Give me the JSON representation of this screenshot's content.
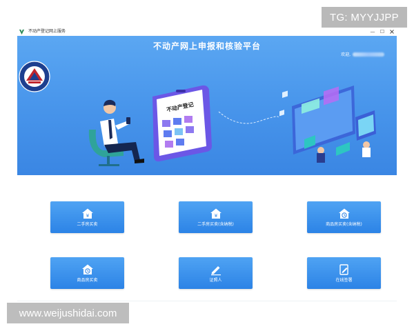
{
  "overlay": {
    "tg_text": "TG: MYYJJPP"
  },
  "window": {
    "title": "不动产登记网上服务",
    "minimize_glyph": "—",
    "maximize_glyph": "☐"
  },
  "banner": {
    "title": "不动产网上申报和核验平台",
    "welcome_label": "欢迎,",
    "tablet_label": "不动产登记"
  },
  "tiles": [
    {
      "label": "二手房买卖",
      "icon": "house-yen-icon"
    },
    {
      "label": "二手房买卖(含纳税)",
      "icon": "house-yen-icon"
    },
    {
      "label": "商品房买卖(含纳税)",
      "icon": "house-clock-icon"
    },
    {
      "label": "商品房买卖",
      "icon": "house-clock-icon"
    },
    {
      "label": "证照人",
      "icon": "pen-icon"
    },
    {
      "label": "在线签署",
      "icon": "sign-document-icon"
    }
  ],
  "watermark": {
    "text": "www.weijushidai.com"
  },
  "colors": {
    "banner_top": "#5ba7f2",
    "banner_bottom": "#3a86e3",
    "tile_top": "#4fa3f3",
    "tile_bottom": "#2c83e6"
  }
}
